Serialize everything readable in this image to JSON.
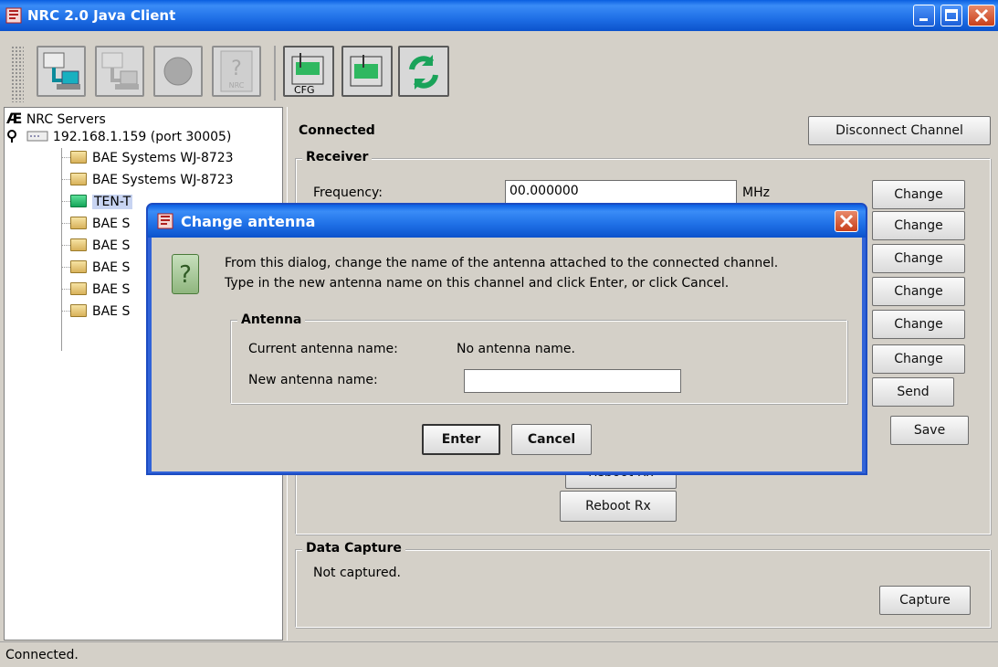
{
  "window": {
    "title": "NRC 2.0 Java Client"
  },
  "toolbar": {
    "cfg_label": "CFG",
    "nrc_label": "NRC",
    "help_glyph": "?"
  },
  "tree": {
    "root": "NRC Servers",
    "root_glyph": "Æ",
    "server": "192.168.1.159 (port 30005)",
    "items": [
      {
        "label": "BAE Systems WJ-8723"
      },
      {
        "label": "BAE Systems WJ-8723"
      },
      {
        "label": "TEN-T"
      },
      {
        "label": "BAE S"
      },
      {
        "label": "BAE S"
      },
      {
        "label": "BAE S"
      },
      {
        "label": "BAE S"
      },
      {
        "label": "BAE S"
      }
    ]
  },
  "main": {
    "status_title": "Connected",
    "disconnect_label": "Disconnect Channel",
    "receiver": {
      "group_label": "Receiver",
      "frequency_label": "Frequency:",
      "frequency_value": "00.000000",
      "frequency_unit": "MHz",
      "change_labels": [
        "Change",
        "Change",
        "Change",
        "Change",
        "Change",
        "Change"
      ],
      "send_label": "Send",
      "save_label": "Save",
      "reboot_label": "Reboot Rx",
      "reboot_label_hidden": "Reboot Rx"
    },
    "capture": {
      "group_label": "Data Capture",
      "status": "Not captured.",
      "capture_label": "Capture"
    }
  },
  "statusbar": {
    "text": "Connected."
  },
  "dialog": {
    "title": "Change antenna",
    "icon_glyph": "?",
    "message_line1": "From this dialog, change the name of the antenna attached to the connected channel.",
    "message_line2": "Type in the new antenna name on this channel and click Enter, or click Cancel.",
    "group_label": "Antenna",
    "current_label": "Current antenna name:",
    "current_value": "No antenna name.",
    "new_label": "New antenna name:",
    "new_value": "",
    "new_placeholder": "",
    "enter_label": "Enter",
    "cancel_label": "Cancel"
  },
  "colors": {
    "titlebar": "#0a5fe0",
    "panel": "#d4d0c8",
    "selection": "#c8d4f2",
    "close": "#c8401b"
  }
}
